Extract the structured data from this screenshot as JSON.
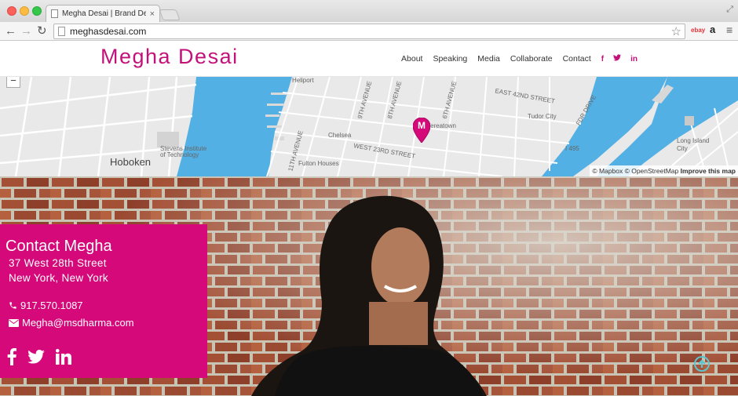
{
  "browser": {
    "tab_title": "Megha Desai | Brand Deve",
    "tab_close": "×",
    "url": "meghasdesai.com",
    "ext_ebay": "ebay",
    "ext_amazon": "a"
  },
  "site": {
    "logo": "Megha Desai",
    "brand_color": "#d5097a",
    "nav": [
      "About",
      "Speaking",
      "Media",
      "Collaborate",
      "Contact"
    ],
    "nav_social": [
      "f",
      "t",
      "in"
    ]
  },
  "map": {
    "zoom_out": "−",
    "pin_letter": "M",
    "labels": {
      "hoboken": "Hoboken",
      "chelsea": "Chelsea",
      "fulton": "Fulton Houses",
      "tudor": "Tudor City",
      "heliport": "Heliport",
      "stevens": "Stevens Institute of Technology",
      "long_island": "Long Island City",
      "w23": "WEST 23RD STREET",
      "e42": "EAST 42ND STREET",
      "ninth": "9TH AVENUE",
      "eighth": "8TH AVENUE",
      "sixth": "6TH AVENUE",
      "eleventh": "11TH AVENUE",
      "i495": "I 495",
      "fdr": "FDR DRIVE",
      "garment": "ereatown"
    },
    "attribution_mapbox": "© Mapbox",
    "attribution_osm": "© OpenStreetMap",
    "attribution_improve": "Improve this map"
  },
  "contact": {
    "title": "Contact Megha",
    "address_line1": "37 West 28th Street",
    "address_line2": "New York, New York",
    "phone": "917.570.1087",
    "email": "Megha@msdharma.com"
  }
}
